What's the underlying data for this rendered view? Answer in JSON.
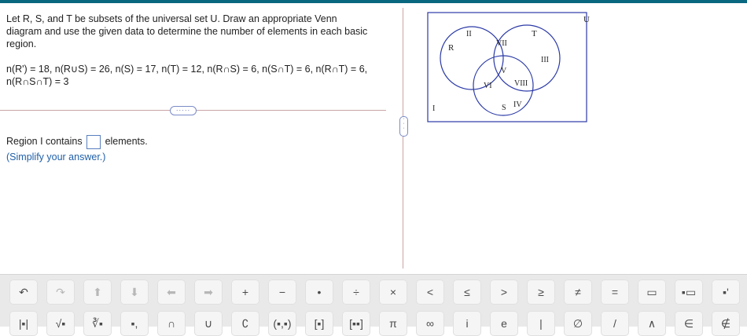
{
  "question": {
    "prompt_line1": "Let R, S, and T be subsets of the universal set U. Draw an appropriate Venn",
    "prompt_line2": "diagram and use the given data to determine the number of elements in each basic",
    "prompt_line3": "region.",
    "data_line1": "n(R') = 18, n(R∪S) = 26, n(S) = 17,  n(T) = 12, n(R∩S) = 6, n(S∩T) = 6,  n(R∩T) = 6,",
    "data_line2": "n(R∩S∩T) = 3"
  },
  "more_button_label": "·····",
  "answer": {
    "prefix": "Region I contains",
    "suffix": "elements.",
    "value": "",
    "hint": "(Simplify your answer.)"
  },
  "venn": {
    "universe_label": "U",
    "set_labels": {
      "r": "R",
      "s": "S",
      "t": "T"
    },
    "regions": {
      "r1": "I",
      "r2": "II",
      "r3": "III",
      "r4": "IV",
      "r5": "V",
      "r6": "VI",
      "r7": "VII",
      "r8": "VIII"
    },
    "border_color": "#2b3aa7"
  },
  "toolbar": {
    "row1": [
      {
        "name": "undo-button",
        "glyph": "↶",
        "dim": false
      },
      {
        "name": "redo-button",
        "glyph": "↷",
        "dim": true
      },
      {
        "name": "up-arrow-button",
        "glyph": "⬆",
        "dim": true
      },
      {
        "name": "down-arrow-button",
        "glyph": "⬇",
        "dim": true
      },
      {
        "name": "left-arrow-button",
        "glyph": "⬅",
        "dim": true
      },
      {
        "name": "right-arrow-button",
        "glyph": "➡",
        "dim": true
      },
      {
        "name": "plus-button",
        "glyph": "+",
        "dim": false
      },
      {
        "name": "minus-button",
        "glyph": "−",
        "dim": false
      },
      {
        "name": "dot-button",
        "glyph": "•",
        "dim": false
      },
      {
        "name": "divide-button",
        "glyph": "÷",
        "dim": false
      },
      {
        "name": "times-button",
        "glyph": "×",
        "dim": false
      },
      {
        "name": "less-than-button",
        "glyph": "<",
        "dim": false
      },
      {
        "name": "less-equal-button",
        "glyph": "≤",
        "dim": false
      },
      {
        "name": "greater-than-button",
        "glyph": ">",
        "dim": false
      },
      {
        "name": "greater-equal-button",
        "glyph": "≥",
        "dim": false
      },
      {
        "name": "not-equal-button",
        "glyph": "≠",
        "dim": false
      },
      {
        "name": "equals-button",
        "glyph": "=",
        "dim": false
      },
      {
        "name": "fraction-button",
        "glyph": "▭",
        "dim": false
      },
      {
        "name": "mixed-number-button",
        "glyph": "▪▭",
        "dim": false
      },
      {
        "name": "exponent-button",
        "glyph": "▪'",
        "dim": false
      }
    ],
    "row2": [
      {
        "name": "abs-button",
        "glyph": "|▪|",
        "dim": false
      },
      {
        "name": "sqrt-button",
        "glyph": "√▪",
        "dim": false
      },
      {
        "name": "nth-root-button",
        "glyph": "∛▪",
        "dim": false
      },
      {
        "name": "subscript-button",
        "glyph": "▪,",
        "dim": false
      },
      {
        "name": "intersection-button",
        "glyph": "∩",
        "dim": false
      },
      {
        "name": "union-button",
        "glyph": "∪",
        "dim": false
      },
      {
        "name": "complement-button",
        "glyph": "∁",
        "dim": false
      },
      {
        "name": "interval-button",
        "glyph": "(▪,▪)",
        "dim": false
      },
      {
        "name": "matrix-button",
        "glyph": "[▪]",
        "dim": false
      },
      {
        "name": "matrix-large-button",
        "glyph": "[▪▪]",
        "dim": false
      },
      {
        "name": "pi-button",
        "glyph": "π",
        "dim": false
      },
      {
        "name": "infinity-button",
        "glyph": "∞",
        "dim": false
      },
      {
        "name": "imaginary-button",
        "glyph": "i",
        "dim": false
      },
      {
        "name": "euler-button",
        "glyph": "e",
        "dim": false
      },
      {
        "name": "bar-button",
        "glyph": "|",
        "dim": false
      },
      {
        "name": "empty-set-button",
        "glyph": "∅",
        "dim": false
      },
      {
        "name": "slash-button",
        "glyph": "/",
        "dim": false
      },
      {
        "name": "and-button",
        "glyph": "∧",
        "dim": false
      },
      {
        "name": "element-of-button",
        "glyph": "∈",
        "dim": false
      },
      {
        "name": "not-element-button",
        "glyph": "∉",
        "dim": false
      },
      {
        "name": "subset-button",
        "glyph": "⊂",
        "dim": false
      }
    ]
  }
}
